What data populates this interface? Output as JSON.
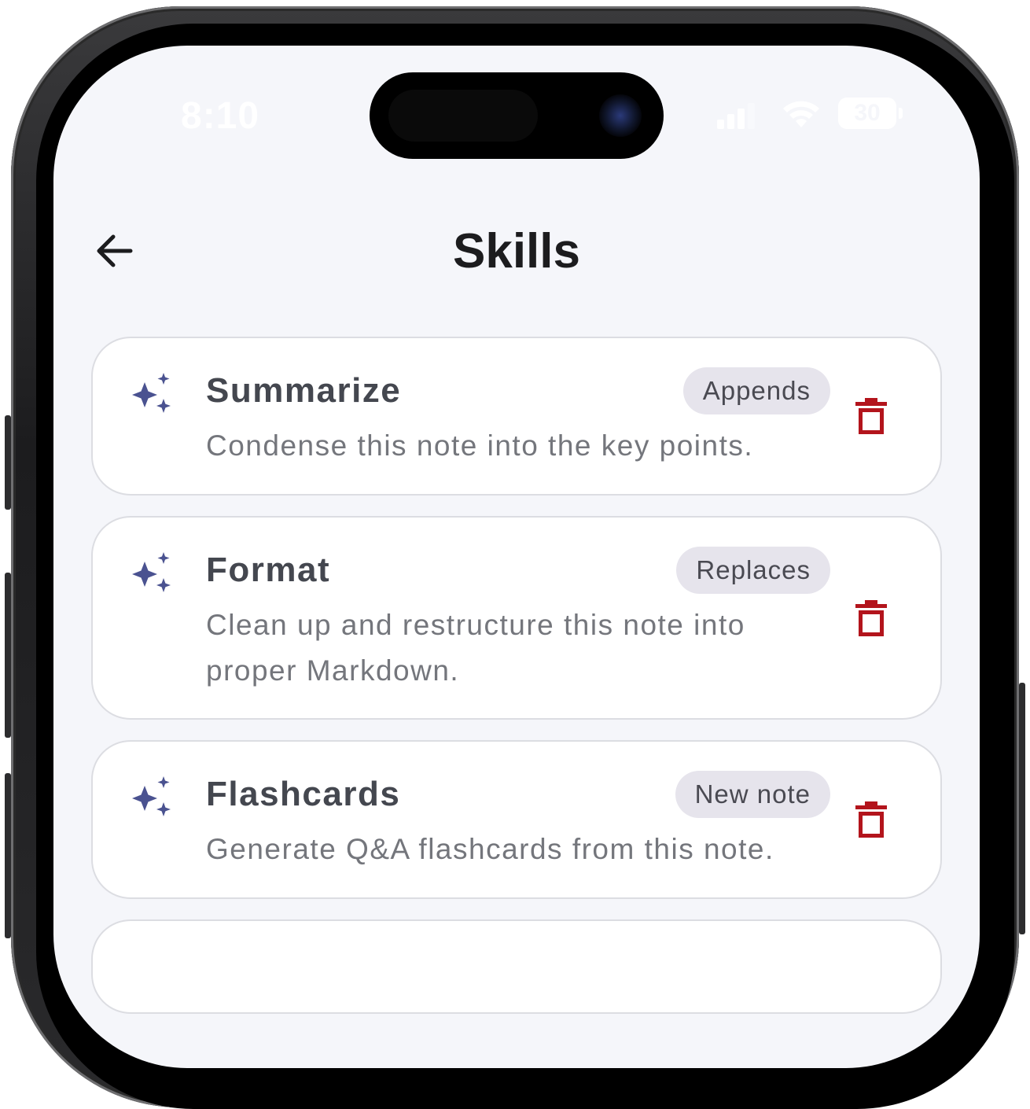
{
  "status_bar": {
    "time": "8:10",
    "battery": "30"
  },
  "header": {
    "title": "Skills",
    "back_icon": "arrow-left-icon"
  },
  "colors": {
    "accent_sparkle": "#4a5290",
    "delete_red": "#b3141c",
    "screen_bg": "#f5f6fa",
    "badge_bg": "#e6e4ec"
  },
  "skills": [
    {
      "name": "Summarize",
      "mode": "Appends",
      "description": "Condense this note into the key points.",
      "icon": "sparkle-icon",
      "delete_icon": "trash-icon"
    },
    {
      "name": "Format",
      "mode": "Replaces",
      "description": "Clean up and restructure this note into proper Markdown.",
      "icon": "sparkle-icon",
      "delete_icon": "trash-icon"
    },
    {
      "name": "Flashcards",
      "mode": "New note",
      "description": "Generate Q&A flashcards from this note.",
      "icon": "sparkle-icon",
      "delete_icon": "trash-icon"
    }
  ]
}
